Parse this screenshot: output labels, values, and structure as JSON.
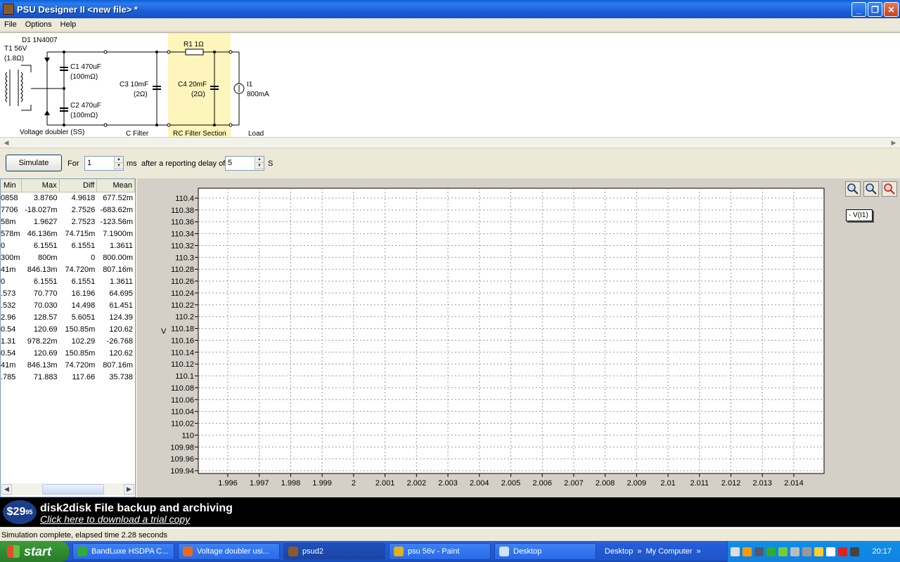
{
  "window": {
    "title": "PSU Designer II  <new file> *"
  },
  "menu": [
    "File",
    "Options",
    "Help"
  ],
  "schematic": {
    "t1_label": "T1 56V",
    "t1_res": "(1.8Ω)",
    "d1_label": "D1 1N4007",
    "c1_label": "C1 470uF",
    "c1_esr": "(100mΩ)",
    "c2_label": "C2 470uF",
    "c2_esr": "(100mΩ)",
    "c3_label": "C3 10mF",
    "c3_esr": "(2Ω)",
    "r1_label": "R1 1Ω",
    "c4_label": "C4 20mF",
    "c4_esr": "(2Ω)",
    "i1_label": "I1",
    "i1_value": "800mA",
    "section_doubler": "Voltage doubler (SS)",
    "section_cfilter": "C Filter",
    "section_rc": "RC Filter Section",
    "section_load": "Load"
  },
  "sim": {
    "button": "Simulate",
    "for_label": "For",
    "duration": "1",
    "duration_unit": "ms",
    "delay_label": "after a reporting delay of",
    "delay": "5",
    "delay_unit": "S"
  },
  "table": {
    "headers": [
      "Min",
      "Max",
      "Diff",
      "Mean"
    ],
    "rows": [
      [
        "0858",
        "3.8760",
        "4.9618",
        "677.52m"
      ],
      [
        "7706",
        "-18.027m",
        "2.7526",
        "-683.62m"
      ],
      [
        "58m",
        "1.9627",
        "2.7523",
        "-123.56m"
      ],
      [
        "578m",
        "46.136m",
        "74.715m",
        "7.1900m"
      ],
      [
        "0",
        "6.1551",
        "6.1551",
        "1.3611"
      ],
      [
        "300m",
        "800m",
        "0",
        "800.00m"
      ],
      [
        "41m",
        "846.13m",
        "74.720m",
        "807.16m"
      ],
      [
        "0",
        "6.1551",
        "6.1551",
        "1.3611"
      ],
      [
        ".573",
        "70.770",
        "16.196",
        "64.695"
      ],
      [
        ".532",
        "70.030",
        "14.498",
        "61.451"
      ],
      [
        "2.96",
        "128.57",
        "5.6051",
        "124.39"
      ],
      [
        "0.54",
        "120.69",
        "150.85m",
        "120.62"
      ],
      [
        "1.31",
        "978.22m",
        "102.29",
        "-26.768"
      ],
      [
        "0.54",
        "120.69",
        "150.85m",
        "120.62"
      ],
      [
        "41m",
        "846.13m",
        "74.720m",
        "807.16m"
      ],
      [
        ".785",
        "71.883",
        "117.66",
        "35.738"
      ]
    ]
  },
  "chart_data": {
    "type": "line",
    "ylabel": "V",
    "ylim": [
      109.94,
      110.4
    ],
    "y_ticks": [
      "110.4",
      "110.38",
      "110.36",
      "110.34",
      "110.32",
      "110.3",
      "110.28",
      "110.26",
      "110.24",
      "110.22",
      "110.2",
      "110.18",
      "110.16",
      "110.14",
      "110.12",
      "110.1",
      "110.08",
      "110.06",
      "110.04",
      "110.02",
      "110",
      "109.98",
      "109.96",
      "109.94"
    ],
    "x_ticks": [
      "1.996",
      "1.997",
      "1.998",
      "1.999",
      "2",
      "2.001",
      "2.002",
      "2.003",
      "2.004",
      "2.005",
      "2.006",
      "2.007",
      "2.008",
      "2.009",
      "2.01",
      "2.011",
      "2.012",
      "2.013",
      "2.014"
    ],
    "grid": true,
    "legend": [
      "V(I1)"
    ],
    "legend_placement": "top-right",
    "series": [
      {
        "name": "V(I1)",
        "values": []
      }
    ]
  },
  "ad": {
    "price": "$29",
    "price_cents": "95",
    "headline": "disk2disk File backup and archiving",
    "link": "Click here to download a trial copy"
  },
  "status": "Simulation complete, elapsed time 2.28 seconds",
  "taskbar": {
    "start": "start",
    "tasks": [
      "BandLuxe HSDPA C...",
      "Voltage doubler usi...",
      "psud2",
      "psu 56v - Paint",
      "Desktop"
    ],
    "quick": [
      "Desktop",
      "My Computer"
    ],
    "clock": "20:17"
  }
}
